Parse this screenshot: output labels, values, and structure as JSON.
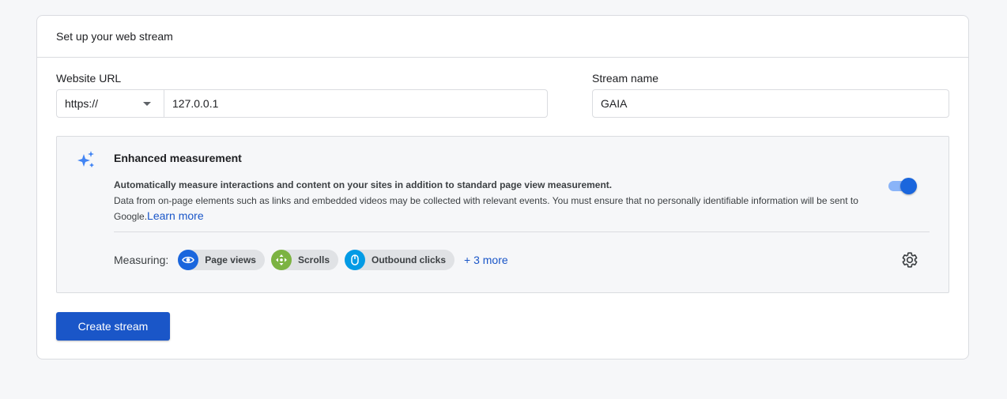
{
  "card": {
    "title": "Set up your web stream"
  },
  "website_url": {
    "label": "Website URL",
    "protocol": "https://",
    "value": "127.0.0.1"
  },
  "stream_name": {
    "label": "Stream name",
    "value": "GAIA"
  },
  "enhanced_measurement": {
    "title": "Enhanced measurement",
    "description_bold": "Automatically measure interactions and content on your sites in addition to standard page view measurement.",
    "description": "Data from on-page elements such as links and embedded videos may be collected with relevant events. You must ensure that no personally identifiable information will be sent to Google.",
    "learn_more": "Learn more",
    "enabled": true,
    "measuring_label": "Measuring:",
    "chips": [
      {
        "label": "Page views",
        "icon": "eye-icon",
        "color": "#1a66dd"
      },
      {
        "label": "Scrolls",
        "icon": "scroll-arrows-icon",
        "color": "#7cb342"
      },
      {
        "label": "Outbound clicks",
        "icon": "mouse-icon",
        "color": "#039be5"
      }
    ],
    "more": "+ 3 more"
  },
  "actions": {
    "create": "Create stream"
  },
  "colors": {
    "accent": "#1a56c8",
    "toggle": "#1a66dd",
    "sparkle": "#4285f4"
  }
}
